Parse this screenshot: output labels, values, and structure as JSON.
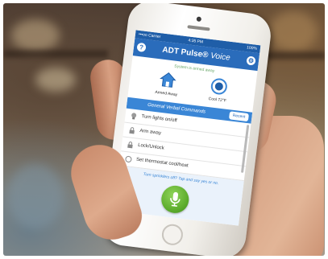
{
  "status_bar": {
    "carrier": "•••oo Carrier",
    "time": "4:35 PM",
    "battery": "100%"
  },
  "header": {
    "title": "ADT Pulse®",
    "subtitle": "Voice"
  },
  "system_status": "System is armed away",
  "modes": [
    {
      "label": "Armed Away",
      "icon": "house-icon"
    },
    {
      "label": "Cool 72°F",
      "icon": "thermostat-icon"
    }
  ],
  "section": {
    "title": "General Verbal Commands",
    "recent_label": "Recent"
  },
  "commands": [
    {
      "label": "Turn lights on/off",
      "icon": "bulb-icon"
    },
    {
      "label": "Arm away",
      "icon": "lock-icon"
    },
    {
      "label": "Lock/Unlock",
      "icon": "lock-icon"
    },
    {
      "label": "Set thermostat cool/heat",
      "icon": "thermostat-icon"
    }
  ],
  "voice": {
    "hint": "Turn sprinklers off? Tap and say yes or no.",
    "mic_icon": "microphone-icon"
  },
  "colors": {
    "brand_blue": "#2a6cbb",
    "section_blue": "#3a86d6",
    "mic_green": "#5fae2e"
  }
}
